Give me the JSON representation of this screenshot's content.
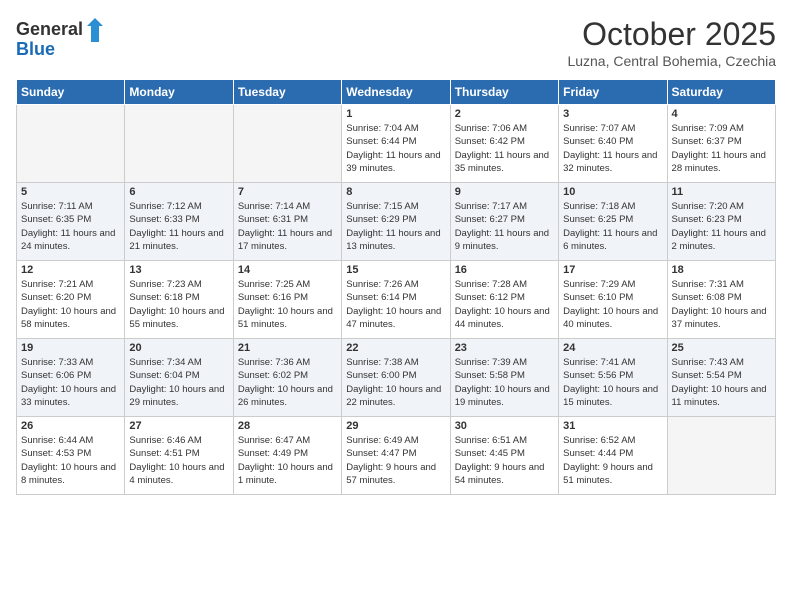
{
  "header": {
    "logo_general": "General",
    "logo_blue": "Blue",
    "month": "October 2025",
    "location": "Luzna, Central Bohemia, Czechia"
  },
  "days_of_week": [
    "Sunday",
    "Monday",
    "Tuesday",
    "Wednesday",
    "Thursday",
    "Friday",
    "Saturday"
  ],
  "weeks": [
    [
      {
        "day": "",
        "text": ""
      },
      {
        "day": "",
        "text": ""
      },
      {
        "day": "",
        "text": ""
      },
      {
        "day": "1",
        "text": "Sunrise: 7:04 AM\nSunset: 6:44 PM\nDaylight: 11 hours and 39 minutes."
      },
      {
        "day": "2",
        "text": "Sunrise: 7:06 AM\nSunset: 6:42 PM\nDaylight: 11 hours and 35 minutes."
      },
      {
        "day": "3",
        "text": "Sunrise: 7:07 AM\nSunset: 6:40 PM\nDaylight: 11 hours and 32 minutes."
      },
      {
        "day": "4",
        "text": "Sunrise: 7:09 AM\nSunset: 6:37 PM\nDaylight: 11 hours and 28 minutes."
      }
    ],
    [
      {
        "day": "5",
        "text": "Sunrise: 7:11 AM\nSunset: 6:35 PM\nDaylight: 11 hours and 24 minutes."
      },
      {
        "day": "6",
        "text": "Sunrise: 7:12 AM\nSunset: 6:33 PM\nDaylight: 11 hours and 21 minutes."
      },
      {
        "day": "7",
        "text": "Sunrise: 7:14 AM\nSunset: 6:31 PM\nDaylight: 11 hours and 17 minutes."
      },
      {
        "day": "8",
        "text": "Sunrise: 7:15 AM\nSunset: 6:29 PM\nDaylight: 11 hours and 13 minutes."
      },
      {
        "day": "9",
        "text": "Sunrise: 7:17 AM\nSunset: 6:27 PM\nDaylight: 11 hours and 9 minutes."
      },
      {
        "day": "10",
        "text": "Sunrise: 7:18 AM\nSunset: 6:25 PM\nDaylight: 11 hours and 6 minutes."
      },
      {
        "day": "11",
        "text": "Sunrise: 7:20 AM\nSunset: 6:23 PM\nDaylight: 11 hours and 2 minutes."
      }
    ],
    [
      {
        "day": "12",
        "text": "Sunrise: 7:21 AM\nSunset: 6:20 PM\nDaylight: 10 hours and 58 minutes."
      },
      {
        "day": "13",
        "text": "Sunrise: 7:23 AM\nSunset: 6:18 PM\nDaylight: 10 hours and 55 minutes."
      },
      {
        "day": "14",
        "text": "Sunrise: 7:25 AM\nSunset: 6:16 PM\nDaylight: 10 hours and 51 minutes."
      },
      {
        "day": "15",
        "text": "Sunrise: 7:26 AM\nSunset: 6:14 PM\nDaylight: 10 hours and 47 minutes."
      },
      {
        "day": "16",
        "text": "Sunrise: 7:28 AM\nSunset: 6:12 PM\nDaylight: 10 hours and 44 minutes."
      },
      {
        "day": "17",
        "text": "Sunrise: 7:29 AM\nSunset: 6:10 PM\nDaylight: 10 hours and 40 minutes."
      },
      {
        "day": "18",
        "text": "Sunrise: 7:31 AM\nSunset: 6:08 PM\nDaylight: 10 hours and 37 minutes."
      }
    ],
    [
      {
        "day": "19",
        "text": "Sunrise: 7:33 AM\nSunset: 6:06 PM\nDaylight: 10 hours and 33 minutes."
      },
      {
        "day": "20",
        "text": "Sunrise: 7:34 AM\nSunset: 6:04 PM\nDaylight: 10 hours and 29 minutes."
      },
      {
        "day": "21",
        "text": "Sunrise: 7:36 AM\nSunset: 6:02 PM\nDaylight: 10 hours and 26 minutes."
      },
      {
        "day": "22",
        "text": "Sunrise: 7:38 AM\nSunset: 6:00 PM\nDaylight: 10 hours and 22 minutes."
      },
      {
        "day": "23",
        "text": "Sunrise: 7:39 AM\nSunset: 5:58 PM\nDaylight: 10 hours and 19 minutes."
      },
      {
        "day": "24",
        "text": "Sunrise: 7:41 AM\nSunset: 5:56 PM\nDaylight: 10 hours and 15 minutes."
      },
      {
        "day": "25",
        "text": "Sunrise: 7:43 AM\nSunset: 5:54 PM\nDaylight: 10 hours and 11 minutes."
      }
    ],
    [
      {
        "day": "26",
        "text": "Sunrise: 6:44 AM\nSunset: 4:53 PM\nDaylight: 10 hours and 8 minutes."
      },
      {
        "day": "27",
        "text": "Sunrise: 6:46 AM\nSunset: 4:51 PM\nDaylight: 10 hours and 4 minutes."
      },
      {
        "day": "28",
        "text": "Sunrise: 6:47 AM\nSunset: 4:49 PM\nDaylight: 10 hours and 1 minute."
      },
      {
        "day": "29",
        "text": "Sunrise: 6:49 AM\nSunset: 4:47 PM\nDaylight: 9 hours and 57 minutes."
      },
      {
        "day": "30",
        "text": "Sunrise: 6:51 AM\nSunset: 4:45 PM\nDaylight: 9 hours and 54 minutes."
      },
      {
        "day": "31",
        "text": "Sunrise: 6:52 AM\nSunset: 4:44 PM\nDaylight: 9 hours and 51 minutes."
      },
      {
        "day": "",
        "text": ""
      }
    ]
  ]
}
